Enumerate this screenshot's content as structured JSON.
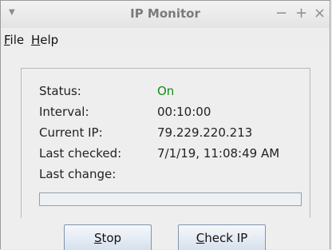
{
  "window": {
    "title": "IP Monitor",
    "menu_button_glyph": "▼",
    "minimize_glyph": "−",
    "maximize_glyph": "+",
    "close_glyph": "×"
  },
  "menubar": {
    "file": {
      "mnemonic": "F",
      "rest": "ile"
    },
    "help": {
      "mnemonic": "H",
      "rest": "elp"
    }
  },
  "fields": {
    "status": {
      "label": "Status:",
      "value": "On",
      "value_color": "#168b16"
    },
    "interval": {
      "label": "Interval:",
      "value": "00:10:00"
    },
    "current_ip": {
      "label": "Current IP:",
      "value": "79.229.220.213"
    },
    "last_checked": {
      "label": "Last checked:",
      "value": "7/1/19, 11:08:49 AM"
    },
    "last_change": {
      "label": "Last change:",
      "value": ""
    }
  },
  "progress": {
    "fraction": 0
  },
  "buttons": {
    "stop": {
      "mnemonic": "S",
      "rest": "top"
    },
    "check_ip": {
      "mnemonic": "C",
      "rest": "heck IP"
    }
  }
}
